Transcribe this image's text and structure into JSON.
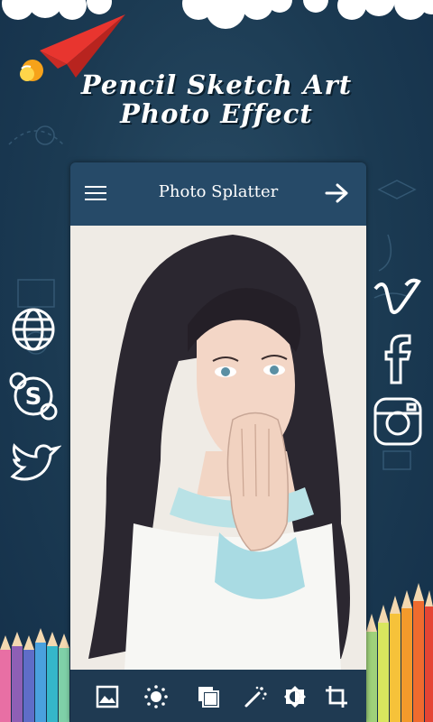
{
  "banner": {
    "title_line1": "Pencil Sketch Art",
    "title_line2": "Photo Effect"
  },
  "app": {
    "title": "Photo Splatter",
    "menu_icon": "hamburger-menu-icon",
    "next_icon": "arrow-right-icon"
  },
  "toolbar": {
    "tools": [
      "gallery-icon",
      "brightness-icon",
      "layers-icon",
      "magic-wand-icon",
      "contrast-icon",
      "crop-icon"
    ]
  },
  "social": {
    "left": [
      "globe-icon",
      "skype-icon",
      "twitter-icon"
    ],
    "right": [
      "vimeo-icon",
      "facebook-icon",
      "instagram-icon"
    ]
  },
  "colors": {
    "background": "#1b3a52",
    "app_bar": "#264a68",
    "bottom_bar": "#1f3a52",
    "rocket": "#e8352f"
  }
}
